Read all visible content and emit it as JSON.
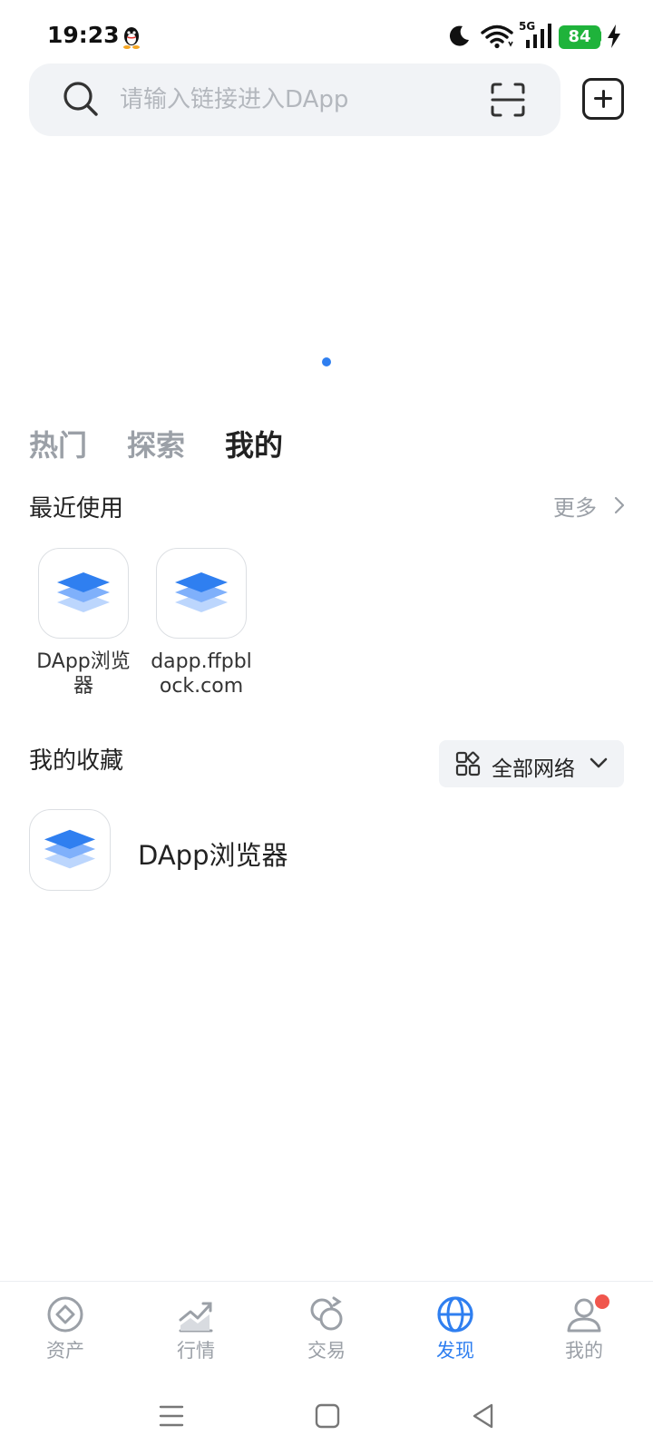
{
  "status_bar": {
    "time": "19:23",
    "network_type": "5G",
    "battery": "84"
  },
  "search": {
    "placeholder": "请输入链接进入DApp"
  },
  "tabs": [
    {
      "label": "热门",
      "active": false
    },
    {
      "label": "探索",
      "active": false
    },
    {
      "label": "我的",
      "active": true
    }
  ],
  "recent": {
    "title": "最近使用",
    "more_label": "更多",
    "apps": [
      {
        "name": "DApp浏览器",
        "icon": "layers-icon"
      },
      {
        "name": "dapp.ffpblock.com",
        "icon": "layers-icon"
      }
    ]
  },
  "favorites": {
    "title": "我的收藏",
    "network_filter": "全部网络",
    "items": [
      {
        "name": "DApp浏览器",
        "icon": "layers-icon"
      }
    ]
  },
  "bottom_nav": [
    {
      "label": "资产",
      "icon": "asset-icon",
      "active": false
    },
    {
      "label": "行情",
      "icon": "market-chart-icon",
      "active": false
    },
    {
      "label": "交易",
      "icon": "swap-icon",
      "active": false
    },
    {
      "label": "发现",
      "icon": "globe-icon",
      "active": true
    },
    {
      "label": "我的",
      "icon": "user-icon",
      "active": false,
      "badge": true
    }
  ],
  "colors": {
    "accent": "#2f7ff0",
    "battery": "#1fb33b",
    "badge": "#f0564d",
    "muted": "#9ba0a7"
  }
}
